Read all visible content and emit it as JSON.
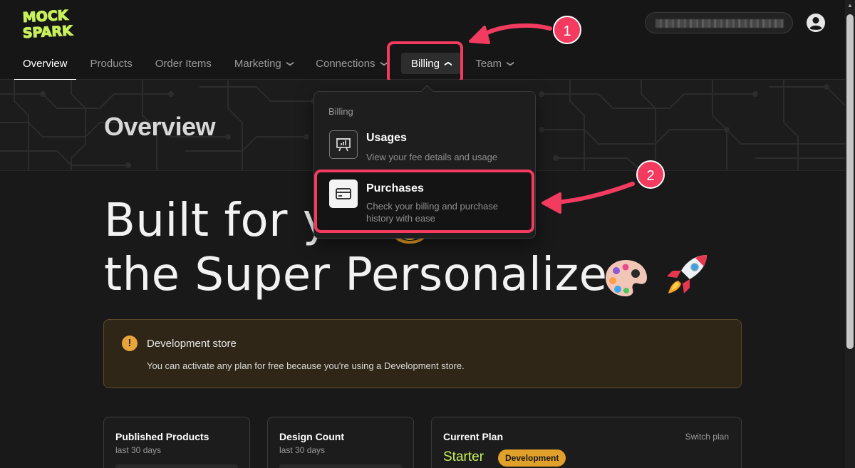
{
  "logo": {
    "line1": "MOCK",
    "line2": "SPARK",
    "color": "#c8f05a"
  },
  "search": {
    "value_obscured": true
  },
  "nav": {
    "items": [
      {
        "label": "Overview",
        "active": true,
        "dropdown": false
      },
      {
        "label": "Products",
        "active": false,
        "dropdown": false
      },
      {
        "label": "Order Items",
        "active": false,
        "dropdown": false
      },
      {
        "label": "Marketing",
        "active": false,
        "dropdown": true
      },
      {
        "label": "Connections",
        "active": false,
        "dropdown": true
      },
      {
        "label": "Billing",
        "active": false,
        "dropdown": true,
        "open": true
      },
      {
        "label": "Team",
        "active": false,
        "dropdown": true
      }
    ]
  },
  "page": {
    "title": "Overview"
  },
  "headline": {
    "line1": "Built for y",
    "line2": "the Super Personalizer"
  },
  "notice": {
    "icon": "!",
    "title": "Development store",
    "text": "You can activate any plan for free because you're using a Development store."
  },
  "cards": [
    {
      "title": "Published Products",
      "subtitle": "last 30 days"
    },
    {
      "title": "Design Count",
      "subtitle": "last 30 days"
    },
    {
      "title": "Current Plan",
      "action": "Switch plan",
      "plan": "Starter",
      "badge": "Development"
    }
  ],
  "dropdown": {
    "header": "Billing",
    "items": [
      {
        "title": "Usages",
        "description": "View your fee details and usage",
        "icon": "usage-chart-icon"
      },
      {
        "title": "Purchases",
        "description": "Check your billing and purchase history with ease",
        "icon": "credit-card-icon"
      }
    ]
  },
  "annotations": {
    "step1": "1",
    "step2": "2",
    "color": "#f23b5f"
  },
  "colors": {
    "accent": "#c8f05a",
    "warning": "#e0a02a",
    "highlight": "#f23b5f",
    "background": "#191919"
  }
}
